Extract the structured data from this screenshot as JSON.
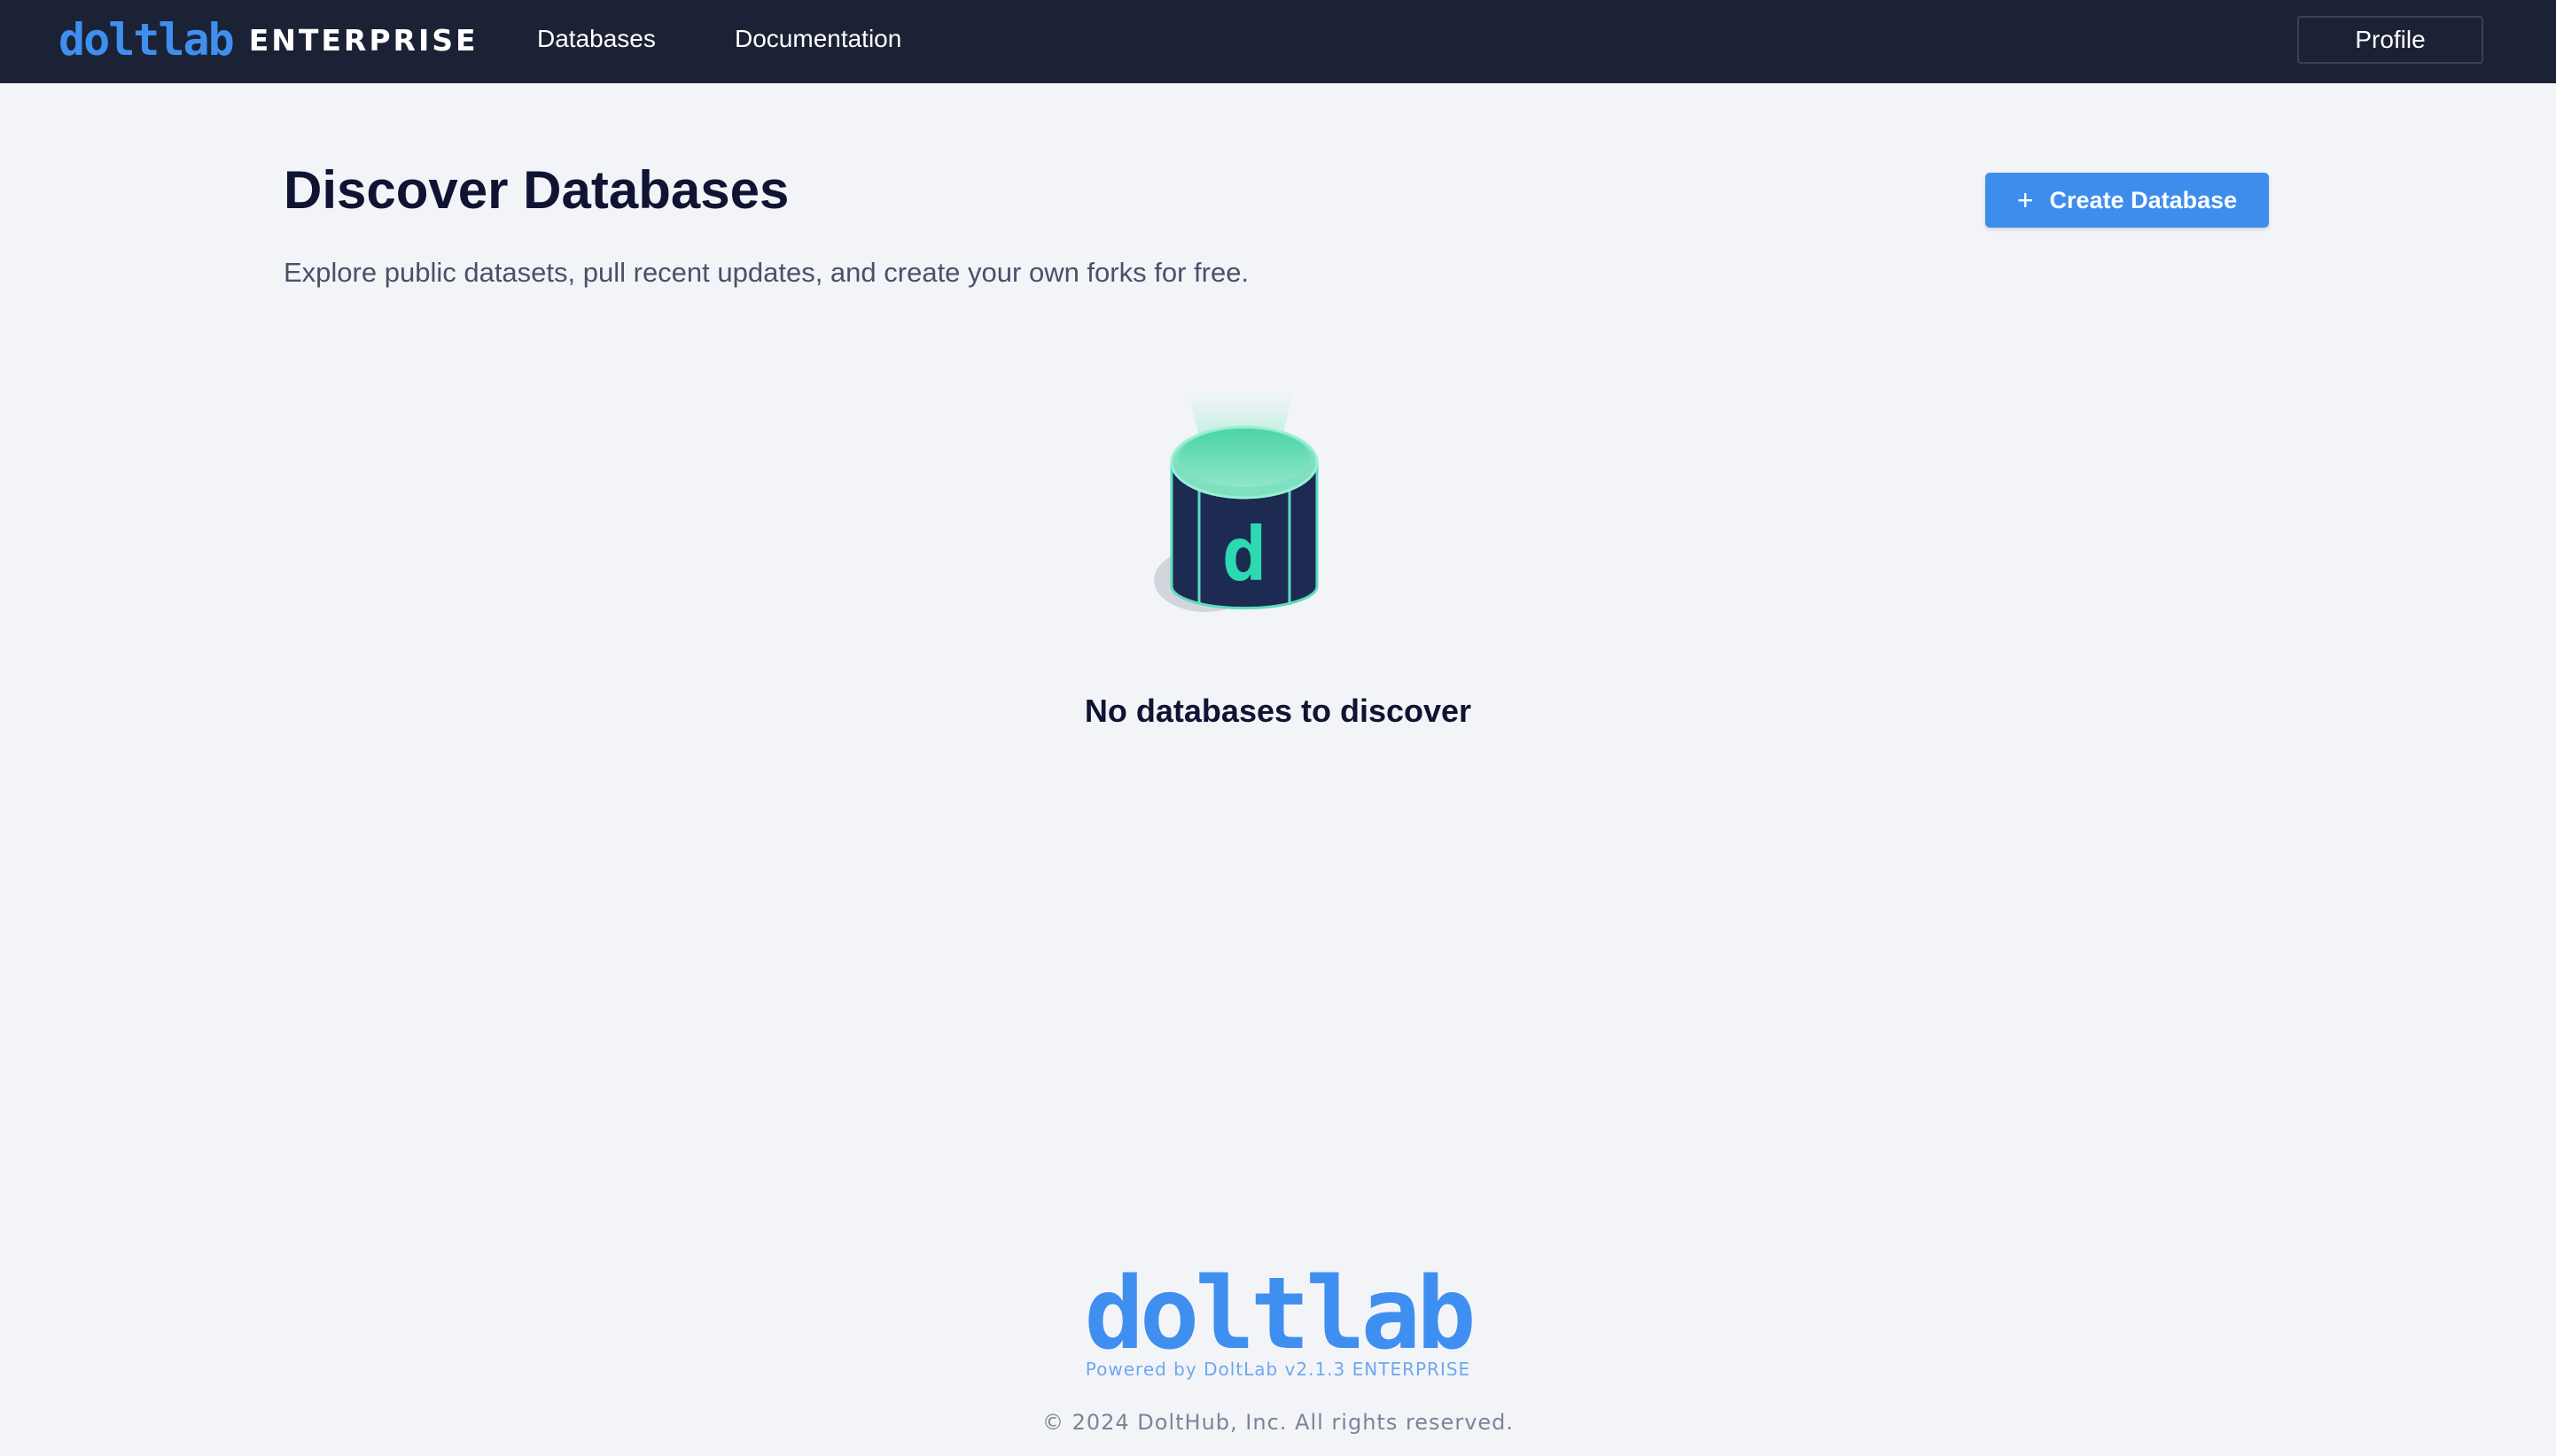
{
  "header": {
    "logo_text": "doltlab",
    "edition": "ENTERPRISE",
    "nav": [
      {
        "label": "Databases"
      },
      {
        "label": "Documentation"
      }
    ],
    "profile_label": "Profile"
  },
  "main": {
    "title": "Discover Databases",
    "subtitle": "Explore public datasets, pull recent updates, and create your own forks for free.",
    "create_button": {
      "icon": "plus-icon",
      "label": "Create Database"
    },
    "empty_state": {
      "icon": "database-icon",
      "icon_glyph": "d",
      "message": "No databases to discover"
    }
  },
  "footer": {
    "logo_text": "doltlab",
    "powered_by": "Powered by DoltLab v2.1.3 ENTERPRISE",
    "copyright": "© 2024 DoltHub, Inc. All rights reserved."
  },
  "colors": {
    "navbar": "#1b2235",
    "brand_blue": "#3f8ff0",
    "button_blue": "#3d8eec",
    "heading": "#0f1433",
    "background": "#f3f4f8",
    "accent_teal": "#2ed8b0"
  }
}
